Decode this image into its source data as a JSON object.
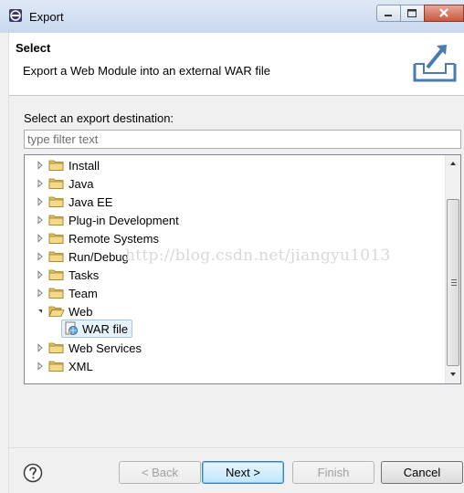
{
  "window": {
    "title": "Export"
  },
  "banner": {
    "title": "Select",
    "description": "Export a Web Module into an external WAR file",
    "icon": "export-wizard-icon"
  },
  "prompt": "Select an export destination:",
  "filter": {
    "placeholder": "type filter text",
    "value": ""
  },
  "tree": {
    "items": [
      {
        "label": "Install",
        "expanded": false
      },
      {
        "label": "Java",
        "expanded": false
      },
      {
        "label": "Java EE",
        "expanded": false
      },
      {
        "label": "Plug-in Development",
        "expanded": false
      },
      {
        "label": "Remote Systems",
        "expanded": false
      },
      {
        "label": "Run/Debug",
        "expanded": false
      },
      {
        "label": "Tasks",
        "expanded": false
      },
      {
        "label": "Team",
        "expanded": false
      },
      {
        "label": "Web",
        "expanded": true
      },
      {
        "label": "Web Services",
        "expanded": false
      },
      {
        "label": "XML",
        "expanded": false
      }
    ],
    "selected_child": {
      "label": "WAR file",
      "parent": "Web"
    }
  },
  "watermark": "http://blog.csdn.net/jiangyu1013",
  "buttons": {
    "back": "< Back",
    "next": "Next >",
    "finish": "Finish",
    "cancel": "Cancel"
  },
  "colors": {
    "folder": "#e8c05a",
    "selection": "#e6f2fc",
    "close_button": "#c85a40"
  }
}
